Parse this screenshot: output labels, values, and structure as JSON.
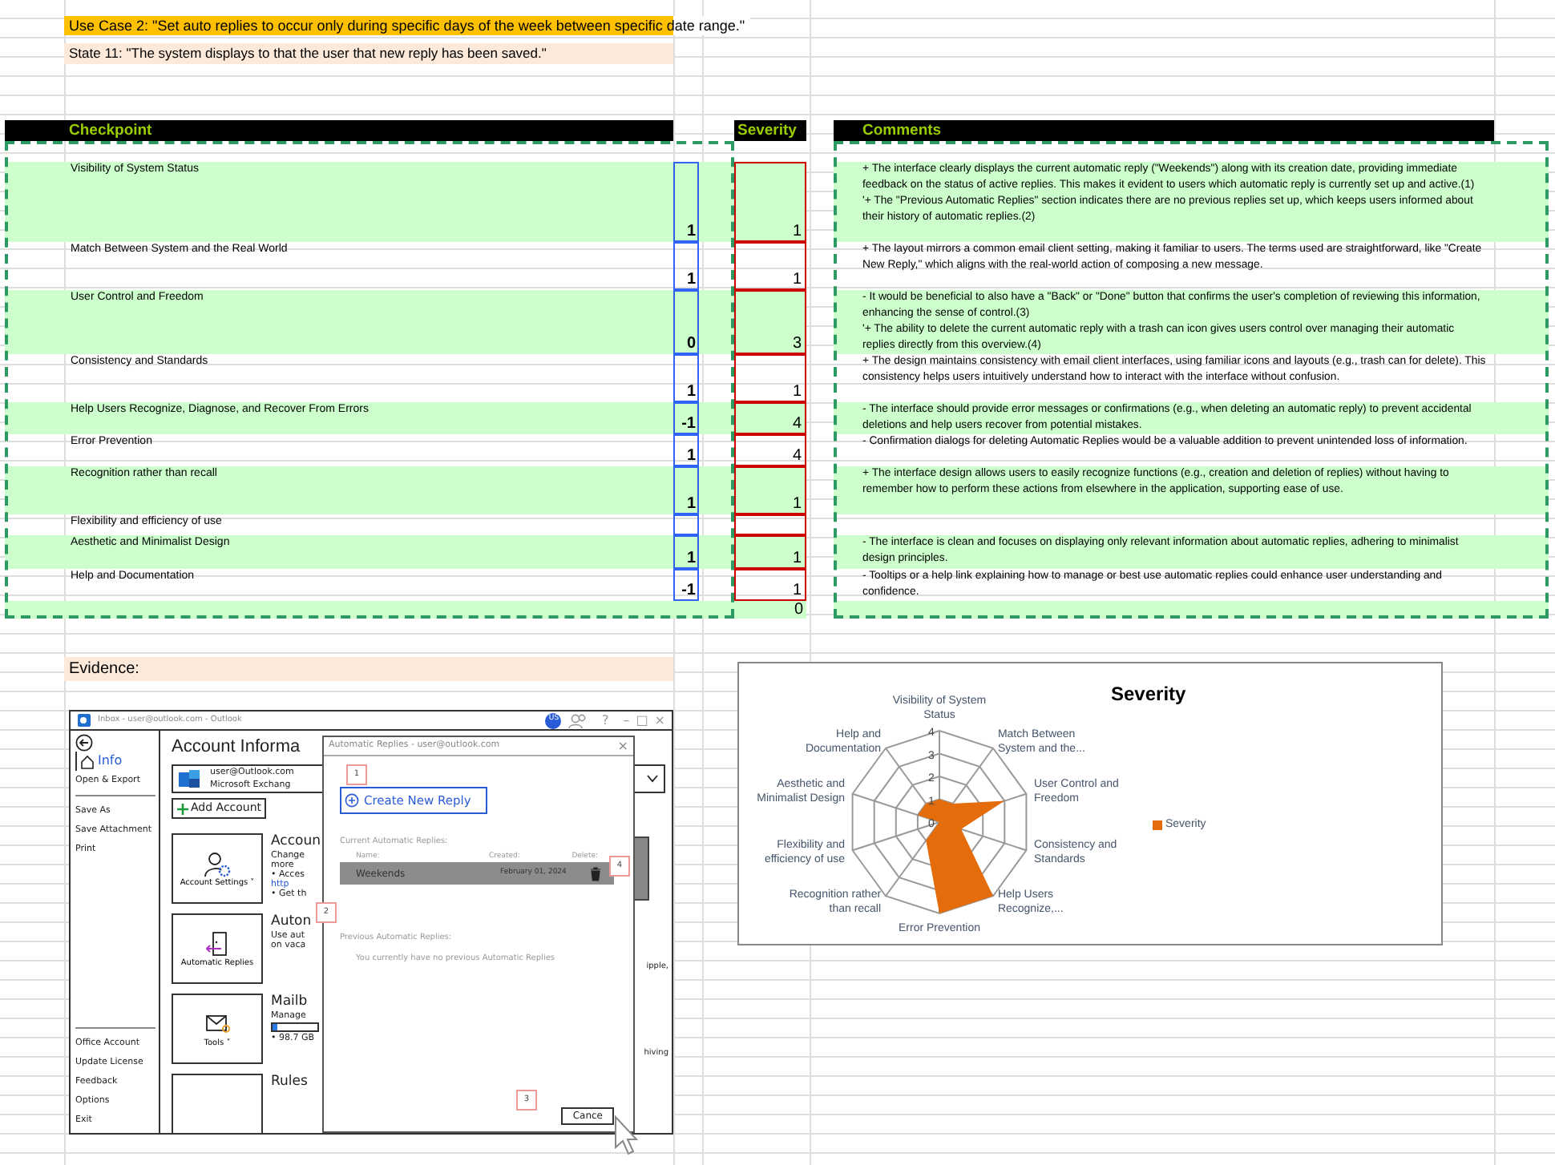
{
  "header": {
    "use_case": "Use Case 2: \"Set auto replies to occur only during specific days of the week between specific date range.\"",
    "state": "State 11: \"The system displays to that the user that new reply has been saved.\""
  },
  "table": {
    "columns": {
      "checkpoint": "Checkpoint",
      "severity": "Severity",
      "comments": "Comments"
    },
    "rows": [
      {
        "checkpoint": "Visibility of System Status",
        "score": "1",
        "severity": "1",
        "comment": "+ The interface clearly displays the current automatic reply (\"Weekends\") along with its creation date, providing immediate feedback on the status of active replies. This makes it evident to users which automatic reply is currently set up and active.(1)\n'+ The \"Previous Automatic Replies\" section indicates there are no previous replies set up, which keeps users informed about their history of automatic replies.(2)"
      },
      {
        "checkpoint": "Match Between System and the Real World",
        "score": "1",
        "severity": "1",
        "comment": "+ The layout mirrors a common email client setting, making it familiar to users. The terms used are straightforward, like \"Create New Reply,\" which aligns with the real-world action of composing a new message."
      },
      {
        "checkpoint": "User Control and Freedom",
        "score": "0",
        "severity": "3",
        "comment": "- It would be beneficial to also have a \"Back\" or \"Done\" button that confirms the user's completion of reviewing this information, enhancing the sense of control.(3)\n'+ The ability to delete the current automatic reply with a trash can icon gives users control over managing their automatic replies directly from this overview.(4)"
      },
      {
        "checkpoint": "Consistency and Standards",
        "score": "1",
        "severity": "1",
        "comment": "+ The design maintains consistency with email client interfaces, using familiar icons and layouts (e.g., trash can for delete). This consistency helps users intuitively understand how to interact with the interface without confusion."
      },
      {
        "checkpoint": "Help Users Recognize, Diagnose, and Recover From Errors",
        "score": "-1",
        "severity": "4",
        "comment": "- The interface should provide error messages or confirmations (e.g., when deleting an automatic reply) to prevent accidental deletions and help users recover from potential mistakes."
      },
      {
        "checkpoint": "Error Prevention",
        "score": "1",
        "severity": "4",
        "comment": "- Confirmation dialogs for deleting Automatic Replies would be a valuable addition to prevent unintended loss of information."
      },
      {
        "checkpoint": "Recognition rather than recall",
        "score": "1",
        "severity": "1",
        "comment": "+ The interface design allows users to easily recognize functions (e.g., creation and deletion of replies) without having to remember how to perform these actions from elsewhere in the application, supporting ease of use."
      },
      {
        "checkpoint": "Flexibility and efficiency of use"
      },
      {
        "checkpoint": "Aesthetic and Minimalist Design",
        "score": "1",
        "severity": "1",
        "comment": "- The interface is clean and focuses on displaying only relevant information about automatic replies, adhering to minimalist design principles."
      },
      {
        "checkpoint": "Help and Documentation",
        "score": "-1",
        "severity": "1",
        "comment": "- Tooltips or a help link explaining how to manage or best use automatic replies could enhance user understanding and confidence."
      }
    ],
    "total": {
      "severity": "0"
    }
  },
  "evidence": {
    "label": "Evidence:",
    "mockup": {
      "title": "Inbox - user@outlook.com - Outlook",
      "avatar": "US",
      "help": "?",
      "window_controls": [
        "–",
        "□",
        "×"
      ],
      "sidebar": [
        {
          "items": [
            {
              "label": "Info",
              "selected": true
            },
            {
              "label": "Open & Export",
              "selected": false
            }
          ]
        },
        {
          "items": [
            {
              "label": "Save As",
              "selected": false
            },
            {
              "label": "Save Attachment",
              "selected": false
            },
            {
              "label": "Print",
              "selected": false
            }
          ]
        },
        {
          "items": [
            {
              "label": "Office Account",
              "selected": false
            },
            {
              "label": "Update License",
              "selected": false
            },
            {
              "label": "Feedback",
              "selected": false
            },
            {
              "label": "Options",
              "selected": false
            },
            {
              "label": "Exit",
              "selected": false
            }
          ]
        }
      ],
      "heading": "Account Informa",
      "account": {
        "email": "user@Outlook.com",
        "type": "Microsoft Exchang"
      },
      "add_account": "Add Account",
      "tiles": [
        {
          "kind": "settings",
          "label": "Account Settings ˅",
          "heading": "Accoun",
          "lines": [
            {
              "kind": "text",
              "text": "Change"
            },
            {
              "kind": "text",
              "text": "more"
            },
            {
              "kind": "text",
              "text": "• Acces"
            },
            {
              "kind": "link",
              "text": "http"
            },
            {
              "kind": "text",
              "text": "• Get th"
            }
          ]
        },
        {
          "kind": "replies",
          "label": "Automatic Replies",
          "heading": "Auton",
          "lines": [
            {
              "kind": "text",
              "text": "Use aut"
            },
            {
              "kind": "text",
              "text": "on vaca"
            }
          ]
        },
        {
          "kind": "tools",
          "label": "Tools ˅",
          "heading": "Mailb",
          "lines": [
            {
              "kind": "text",
              "text": "Manage"
            },
            {
              "kind": "meter",
              "level": 0.1
            },
            {
              "kind": "text",
              "text": "• 98.7 GB"
            }
          ]
        },
        {
          "kind": "blank",
          "heading": "Rules"
        }
      ],
      "edge_texts": [
        "ipple,",
        "hiving"
      ],
      "dialog": {
        "title": "Automatic Replies - user@outlook.com",
        "close": "×",
        "create_button": "Create New Reply",
        "current_label": "Current Automatic Replies:",
        "columns": [
          "Name:",
          "Created:",
          "Delete:"
        ],
        "replies": [
          {
            "name": "Weekends",
            "created": "February 01, 2024",
            "selected": true
          }
        ],
        "previous_label": "Previous Automatic Replies:",
        "empty_message": "You currently have no previous Automatic Replies",
        "cancel": "Cance",
        "callouts": [
          "1",
          "2",
          "3",
          "4"
        ]
      }
    }
  },
  "chart": {
    "chart_data": {
      "type": "radar",
      "title": "Severity",
      "categories": [
        "Visibility of System Status",
        "Match Between System and the...",
        "User Control and Freedom",
        "Consistency and Standards",
        "Help Users Recognize,...",
        "Error Prevention",
        "Recognition rather than recall",
        "Flexibility and efficiency of use",
        "Aesthetic and Minimalist Design",
        "Help and Documentation"
      ],
      "series": [
        {
          "name": "Severity",
          "color": "#e46c0a",
          "values": [
            1,
            1,
            3,
            1,
            4,
            4,
            1,
            0,
            1,
            1
          ]
        }
      ],
      "ylim": [
        0,
        4
      ],
      "yticks": [
        0,
        1,
        2,
        3,
        4
      ]
    }
  }
}
